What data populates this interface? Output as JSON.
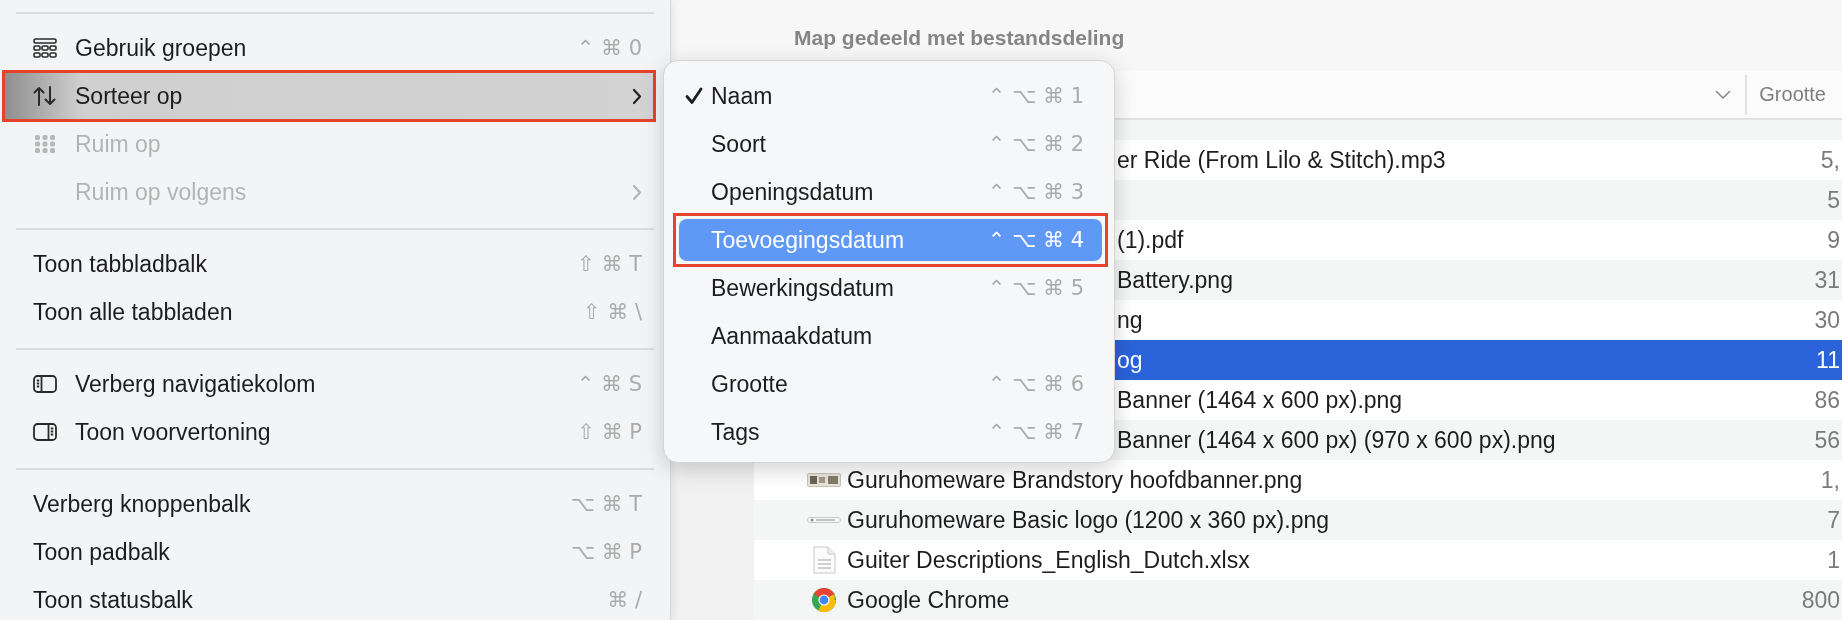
{
  "menu": {
    "groups": [
      [
        {
          "label": "Gebruik groepen",
          "kind": "groups",
          "shortcut": "⌃ ⌘ 0",
          "selected": false,
          "disabled": false,
          "submenu": false
        },
        {
          "label": "Sorteer op",
          "kind": "sort",
          "selected": true,
          "disabled": false,
          "submenu": true
        },
        {
          "label": "Ruim op",
          "kind": "grid",
          "selected": false,
          "disabled": true,
          "submenu": false
        },
        {
          "label": "Ruim op volgens",
          "selected": false,
          "disabled": true,
          "submenu": true
        }
      ],
      [
        {
          "label": "Toon tabbladbalk",
          "shortcut": "⇧ ⌘ T",
          "selected": false,
          "disabled": false,
          "submenu": false
        },
        {
          "label": "Toon alle tabbladen",
          "shortcut": "⇧ ⌘ \\",
          "selected": false,
          "disabled": false,
          "submenu": false
        }
      ],
      [
        {
          "label": "Verberg navigatiekolom",
          "kind": "sidebar",
          "shortcut": "⌃ ⌘ S",
          "selected": false,
          "disabled": false,
          "submenu": false
        },
        {
          "label": "Toon voorvertoning",
          "kind": "preview",
          "shortcut": "⇧ ⌘ P",
          "selected": false,
          "disabled": false,
          "submenu": false
        }
      ],
      [
        {
          "label": "Verberg knoppenbalk",
          "shortcut": "⌥ ⌘ T",
          "selected": false,
          "disabled": false,
          "submenu": false
        },
        {
          "label": "Toon padbalk",
          "shortcut": "⌥ ⌘ P",
          "selected": false,
          "disabled": false,
          "submenu": false
        },
        {
          "label": "Toon statusbalk",
          "shortcut": "⌘ /",
          "selected": false,
          "disabled": false,
          "submenu": false
        }
      ]
    ]
  },
  "submenu": {
    "items": [
      {
        "label": "Naam",
        "shortcut": "⌃ ⌥ ⌘ 1",
        "checked": true,
        "selected": false
      },
      {
        "label": "Soort",
        "shortcut": "⌃ ⌥ ⌘ 2",
        "checked": false,
        "selected": false
      },
      {
        "label": "Openingsdatum",
        "shortcut": "⌃ ⌥ ⌘ 3",
        "checked": false,
        "selected": false
      },
      {
        "label": "Toevoegingsdatum",
        "shortcut": "⌃ ⌥ ⌘ 4",
        "checked": false,
        "selected": true
      },
      {
        "label": "Bewerkingsdatum",
        "shortcut": "⌃ ⌥ ⌘ 5",
        "checked": false,
        "selected": false
      },
      {
        "label": "Aanmaakdatum",
        "checked": false,
        "selected": false
      },
      {
        "label": "Grootte",
        "shortcut": "⌃ ⌥ ⌘ 6",
        "checked": false,
        "selected": false
      },
      {
        "label": "Tags",
        "shortcut": "⌃ ⌥ ⌘ 7",
        "checked": false,
        "selected": false
      }
    ]
  },
  "finder": {
    "title": "Map gedeeld met bestandsdeling",
    "columns": [
      {
        "label": "Grootte"
      }
    ],
    "rows": [
      {
        "kind": "clipped",
        "name": "er Ride (From Lilo & Stitch).mp3",
        "size": "5,",
        "selected": false
      },
      {
        "kind": "clipped",
        "size": "5",
        "selected": false
      },
      {
        "kind": "clipped",
        "name": "(1).pdf",
        "size": "9",
        "selected": false
      },
      {
        "kind": "clipped",
        "name": "Battery.png",
        "size": "31",
        "selected": false
      },
      {
        "kind": "clipped",
        "name": "ng",
        "size": "30",
        "selected": false
      },
      {
        "kind": "clipped",
        "name": "og",
        "size": "11",
        "selected": true
      },
      {
        "kind": "clipped",
        "name": "Banner (1464 x 600 px).png",
        "size": "86",
        "selected": false
      },
      {
        "kind": "clipped",
        "name": "Banner (1464 x 600 px) (970 x 600 px).png",
        "size": "56",
        "selected": false
      },
      {
        "kind": "photo",
        "name": "Guruhomeware Brandstory hoofdbanner.png",
        "size": "1,",
        "selected": false
      },
      {
        "kind": "logo",
        "name": "Guruhomeware Basic logo (1200 x 360 px).png",
        "size": "7",
        "selected": false
      },
      {
        "kind": "sheet",
        "name": "Guiter Descriptions_English_Dutch.xlsx",
        "size": "1",
        "selected": false
      },
      {
        "kind": "app",
        "name": "Google Chrome",
        "size": "800",
        "selected": false
      }
    ]
  }
}
